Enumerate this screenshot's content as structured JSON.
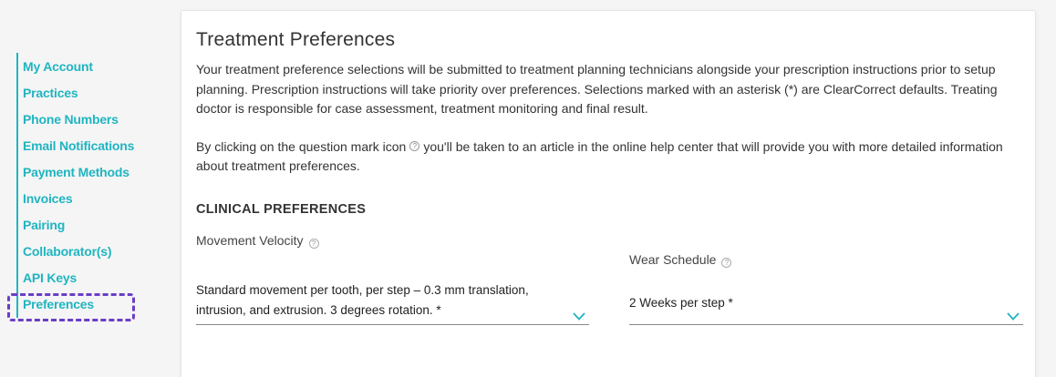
{
  "sidebar": {
    "items": [
      {
        "label": "My Account"
      },
      {
        "label": "Practices"
      },
      {
        "label": "Phone Numbers"
      },
      {
        "label": "Email Notifications"
      },
      {
        "label": "Payment Methods"
      },
      {
        "label": "Invoices"
      },
      {
        "label": "Pairing"
      },
      {
        "label": "Collaborator(s)"
      },
      {
        "label": "API Keys"
      },
      {
        "label": "Preferences"
      }
    ],
    "highlight_color": "#6a3ec7",
    "accent_color": "#1fb5c1"
  },
  "main": {
    "title": "Treatment Preferences",
    "intro": "Your treatment preference selections will be submitted to treatment planning technicians alongside your prescription instructions prior to setup planning. Prescription instructions will take priority over preferences. Selections marked with an asterisk (*) are ClearCorrect defaults. Treating doctor is responsible for case assessment, treatment monitoring and final result.",
    "help_before": "By clicking on the question mark icon",
    "help_after": "you'll be taken to an article in the online help center that will provide you with more detailed information about treatment preferences.",
    "help_icon_glyph": "?",
    "section_title": "CLINICAL PREFERENCES",
    "movement_velocity": {
      "label": "Movement Velocity",
      "value": "Standard movement per tooth, per step – 0.3 mm translation, intrusion, and extrusion. 3 degrees rotation. *"
    },
    "wear_schedule": {
      "label": "Wear Schedule",
      "value": "2 Weeks per step *"
    }
  }
}
